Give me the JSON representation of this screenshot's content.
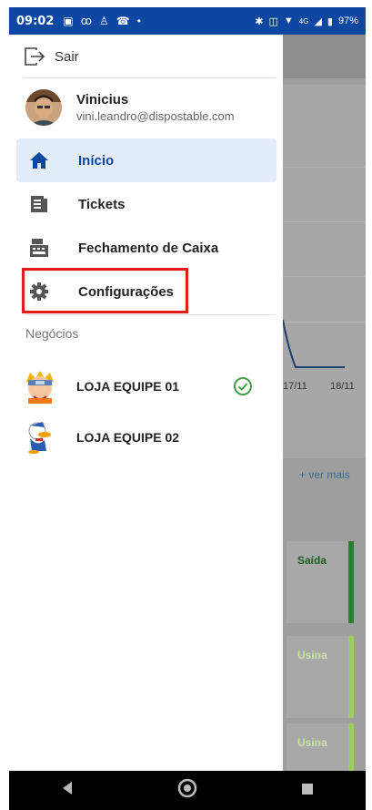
{
  "status_bar": {
    "time": "09:02",
    "battery": "97%",
    "network": "4G"
  },
  "drawer": {
    "logout_label": "Sair",
    "user": {
      "name": "Vinicius",
      "email": "vini.leandro@dispostable.com"
    },
    "nav": [
      {
        "label": "Início",
        "icon": "home-icon",
        "active": true
      },
      {
        "label": "Tickets",
        "icon": "ticket-icon",
        "active": false
      },
      {
        "label": "Fechamento de Caixa",
        "icon": "cash-register-icon",
        "active": false
      },
      {
        "label": "Configurações",
        "icon": "gear-icon",
        "active": false
      }
    ],
    "businesses_title": "Negócios",
    "businesses": [
      {
        "name": "LOJA EQUIPE 01",
        "selected": true
      },
      {
        "name": "LOJA EQUIPE 02",
        "selected": false
      }
    ]
  },
  "background": {
    "chart_dates": [
      "17/11",
      "18/11"
    ],
    "see_more": "+ ver mais",
    "tiles": [
      "Saída",
      "Usina",
      "Usina"
    ]
  },
  "colors": {
    "primary": "#0d47a1",
    "active_bg": "#e3edfa",
    "highlight": "#e31b1b",
    "success": "#43a047"
  }
}
